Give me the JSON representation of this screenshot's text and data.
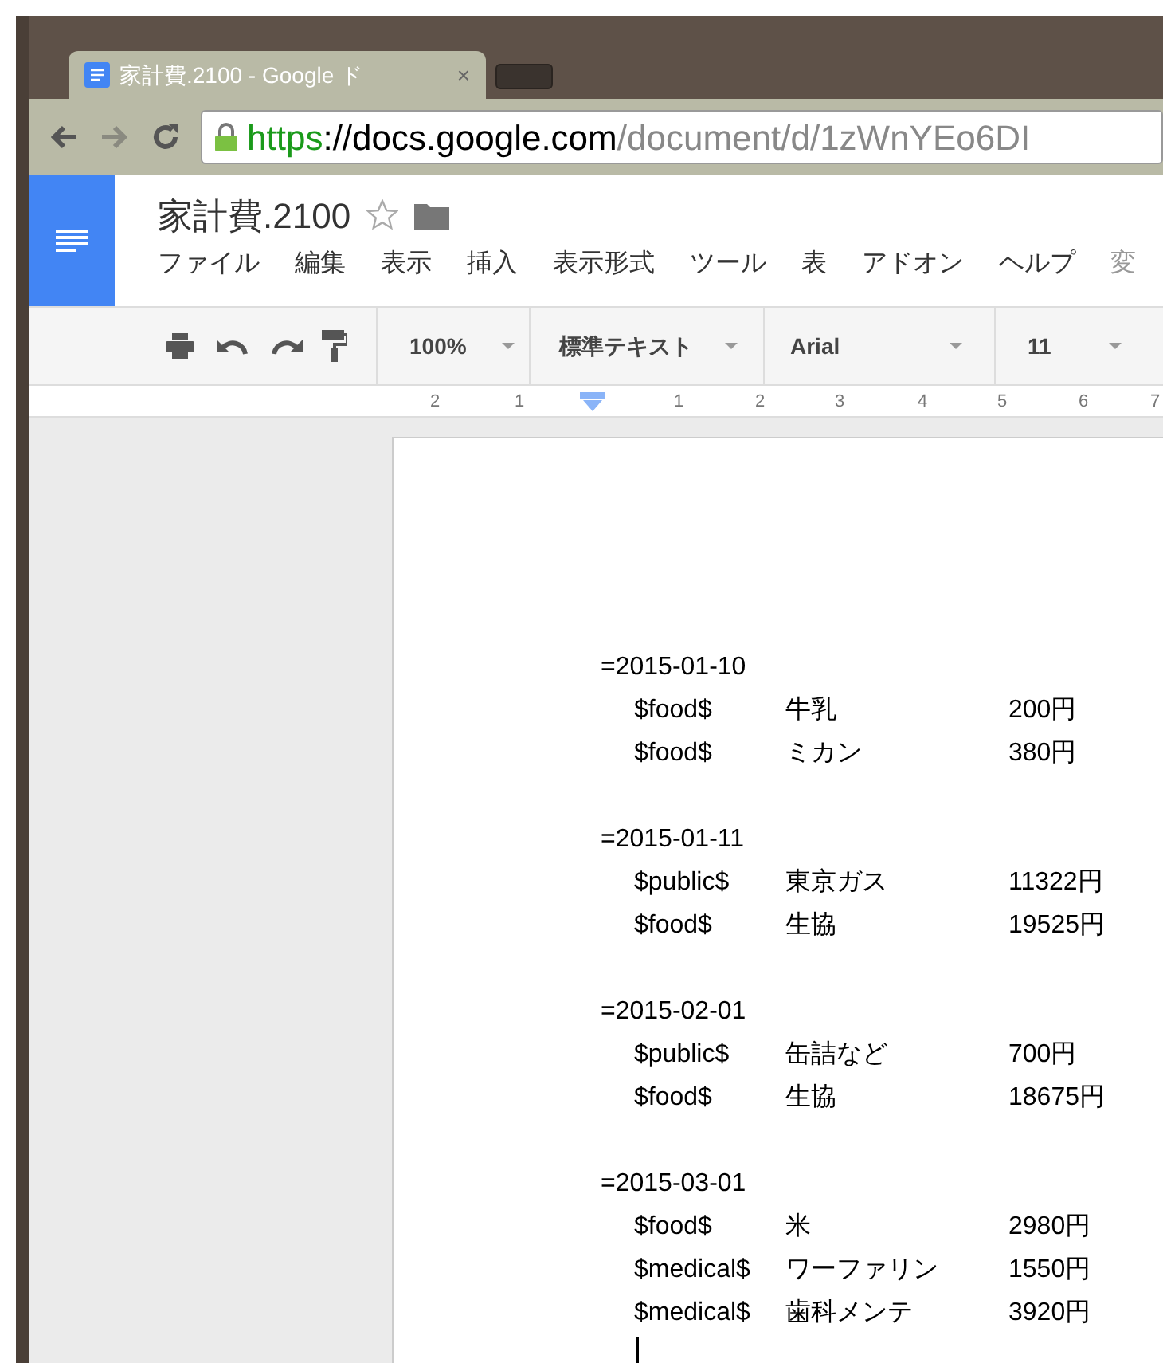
{
  "browser": {
    "tab_title": "家計費.2100 - Google ド",
    "tab_close": "×",
    "url_scheme": "https",
    "url_host": "://docs.google.com",
    "url_path": "/document/d/1zWnYEo6DI"
  },
  "document": {
    "title": "家計費.2100",
    "starred": false
  },
  "menu": [
    "ファイル",
    "編集",
    "表示",
    "挿入",
    "表示形式",
    "ツール",
    "表",
    "アドオン",
    "ヘルプ",
    "変"
  ],
  "toolbar": {
    "zoom": "100%",
    "style": "標準テキスト",
    "font": "Arial",
    "size": "11"
  },
  "ruler": [
    "2",
    "1",
    "1",
    "2",
    "3",
    "4",
    "5",
    "6",
    "7"
  ],
  "groups": [
    {
      "date": "=2015-01-10",
      "entries": [
        {
          "category": "$food$",
          "item": "牛乳",
          "amount": "200円"
        },
        {
          "category": "$food$",
          "item": "ミカン",
          "amount": "380円"
        }
      ]
    },
    {
      "date": "=2015-01-11",
      "entries": [
        {
          "category": "$public$",
          "item": "東京ガス",
          "amount": "11322円"
        },
        {
          "category": "$food$",
          "item": "生協",
          "amount": "19525円"
        }
      ]
    },
    {
      "date": "=2015-02-01",
      "entries": [
        {
          "category": "$public$",
          "item": "缶詰など",
          "amount": "700円"
        },
        {
          "category": "$food$",
          "item": "生協",
          "amount": "18675円"
        }
      ]
    },
    {
      "date": "=2015-03-01",
      "entries": [
        {
          "category": "$food$",
          "item": "米",
          "amount": "2980円"
        },
        {
          "category": "$medical$",
          "item": "ワーファリン",
          "amount": "1550円"
        },
        {
          "category": "$medical$",
          "item": "歯科メンテ",
          "amount": "3920円"
        }
      ]
    }
  ]
}
